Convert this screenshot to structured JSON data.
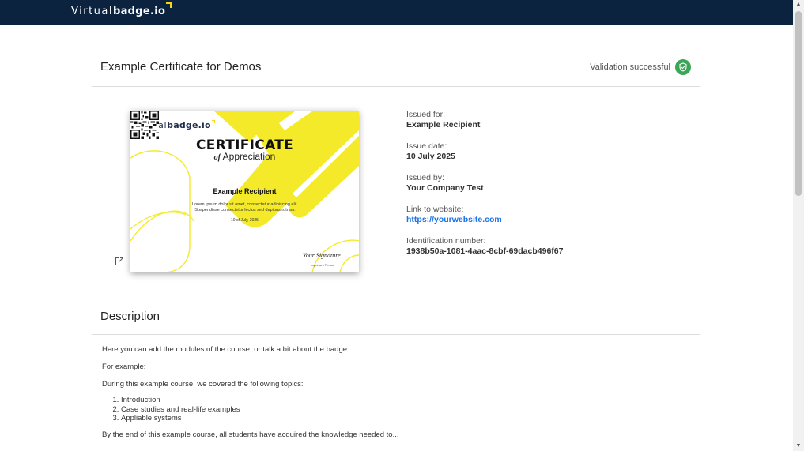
{
  "brand": {
    "name_light": "Virtual",
    "name_bold": "badge.io",
    "accent": "#f5d915",
    "navbar_color": "#0c2340"
  },
  "certificate": {
    "title": "Example Certificate for Demos",
    "validation_text": "Validation successful",
    "validation_color": "#3aa757"
  },
  "certificate_image": {
    "heading": "CERTIFICATE",
    "sub_of": "of",
    "sub_word": "Appreciation",
    "recipient": "Example Recipient",
    "lorem_line1": "Lorem ipsum dolor sit amet, consectetur adipiscing elit.",
    "lorem_line2": "Suspendisse consectetur lectus sed dapibus rutrum.",
    "date": "10 of July, 2025",
    "signature": "Your Signature",
    "signature_name": "Important Person"
  },
  "details": {
    "issued_for_label": "Issued for:",
    "issued_for_value": "Example Recipient",
    "issue_date_label": "Issue date:",
    "issue_date_value": "10 July 2025",
    "issued_by_label": "Issued by:",
    "issued_by_value": "Your Company Test",
    "website_label": "Link to website:",
    "website_value": "https://yourwebsite.com",
    "id_label": "Identification number:",
    "id_value": "1938b50a-1081-4aac-8cbf-69dacb496f67"
  },
  "description": {
    "title": "Description",
    "intro": "Here you can add the modules of the course, or talk a bit about the badge.",
    "example_label": "For example:",
    "topics_intro": "During this example course, we covered the following topics:",
    "topics": [
      "Introduction",
      "Case studies and real-life examples",
      "Appliable systems"
    ],
    "closing": "By the end of this example course, all students have acquired the knowledge needed to..."
  },
  "icons": {
    "validation": "shield-check-icon",
    "external_link": "external-link-icon"
  }
}
